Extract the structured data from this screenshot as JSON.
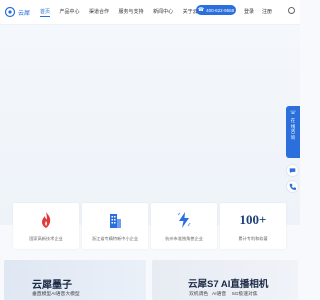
{
  "header": {
    "logo_text": "云犀",
    "nav": [
      "首页",
      "产品中心",
      "渠道合作",
      "服务与支持",
      "新闻中心",
      "关于云犀"
    ],
    "phone": "400-622-9558",
    "login": "登录",
    "register": "注册"
  },
  "float_panel": {
    "label": "在线咨询"
  },
  "cards": [
    {
      "icon": "fire-icon",
      "label": "国家高新技术企业"
    },
    {
      "icon": "building-icon",
      "label": "浙江省专精特新中小企业"
    },
    {
      "icon": "lightning-icon",
      "label": "杭州市准独角兽企业"
    },
    {
      "big": "100+",
      "label": "累计专利和软著"
    }
  ],
  "banners": {
    "left_title": "云犀墨子",
    "left_sub": "垂直模型AI语音大模型",
    "right_title": "云犀S7 AI直播相机",
    "right_sub": [
      "双机调色",
      "AI语音",
      "5G极速对焦"
    ]
  },
  "colors": {
    "accent": "#2a6fdb",
    "card_icon_red": "#e03a3a",
    "card_icon_blue": "#2a6fdb",
    "dark_navy": "#1e3f7a"
  }
}
